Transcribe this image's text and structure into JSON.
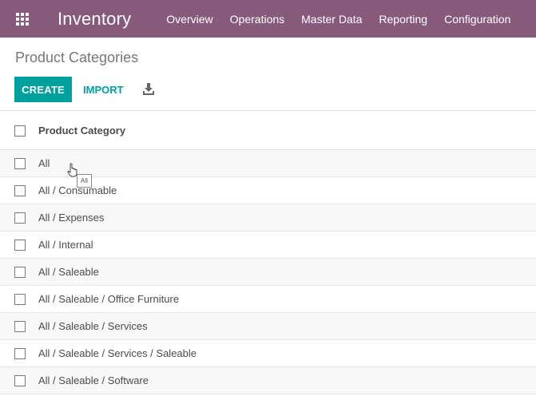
{
  "navbar": {
    "brand": "Inventory",
    "menu": [
      "Overview",
      "Operations",
      "Master Data",
      "Reporting",
      "Configuration"
    ],
    "background": "#875a7b"
  },
  "control_panel": {
    "title": "Product Categories",
    "create_label": "CREATE",
    "import_label": "IMPORT",
    "accent": "#00a09d"
  },
  "list": {
    "column_header": "Product Category",
    "rows": [
      "All",
      "All / Consumable",
      "All / Expenses",
      "All / Internal",
      "All / Saleable",
      "All / Saleable / Office Furniture",
      "All / Saleable / Services",
      "All / Saleable / Services / Saleable",
      "All / Saleable / Software"
    ]
  },
  "tooltip": {
    "text": "All"
  },
  "icons": {
    "apps": "apps-grid-icon",
    "download": "download-icon",
    "cursor": "hand-pointer-icon"
  }
}
